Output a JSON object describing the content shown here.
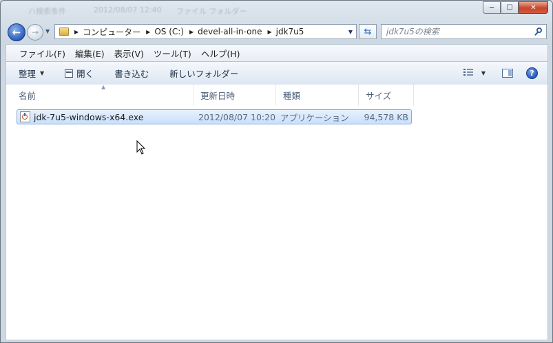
{
  "window": {
    "behind_text": [
      "ハ検索条件",
      "2012/08/07 12:40",
      "ファイル フォルダー"
    ],
    "captions": {
      "minimize": "─",
      "maximize": "☐",
      "close": "✕"
    }
  },
  "nav": {
    "back_icon": "back-arrow-icon",
    "forward_icon": "forward-arrow-icon",
    "breadcrumb": [
      "コンピューター",
      "OS (C:)",
      "devel-all-in-one",
      "jdk7u5"
    ],
    "search_placeholder": "jdk7u5の検索"
  },
  "menubar": {
    "items": [
      "ファイル(F)",
      "編集(E)",
      "表示(V)",
      "ツール(T)",
      "ヘルプ(H)"
    ]
  },
  "commandbar": {
    "organize": "整理",
    "open": "開く",
    "burn": "書き込む",
    "new_folder": "新しいフォルダー"
  },
  "columns": [
    "名前",
    "更新日時",
    "種類",
    "サイズ"
  ],
  "files": [
    {
      "name": "jdk-7u5-windows-x64.exe",
      "modified": "2012/08/07 10:20",
      "type": "アプリケーション",
      "size": "94,578 KB",
      "selected": true
    }
  ],
  "colors": {
    "selection_bg": "#c9e0fb",
    "selection_border": "#84acdd",
    "close_button": "#c8462b"
  }
}
